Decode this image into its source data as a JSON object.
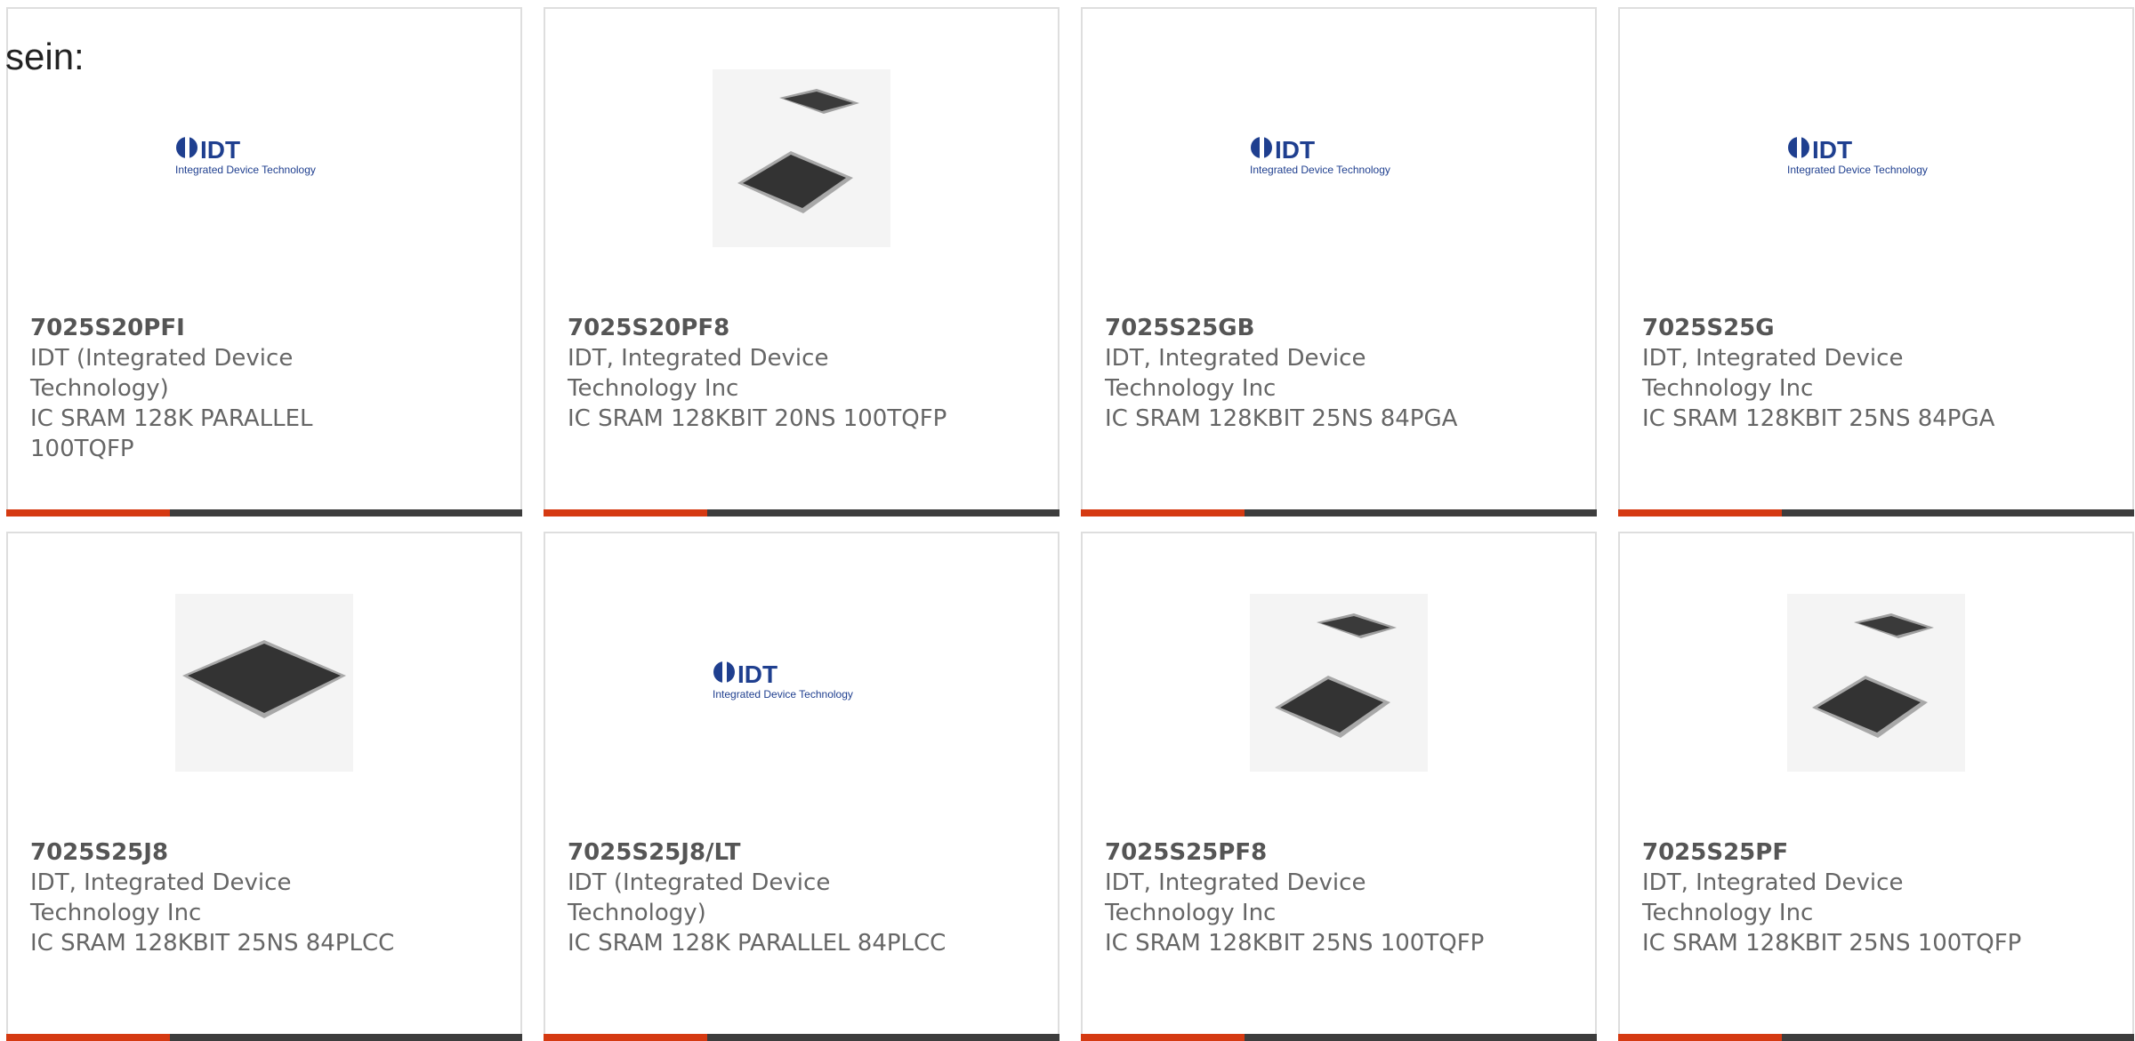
{
  "intro_text": "sein:",
  "colors": {
    "accent_orange": "#d53a12",
    "accent_dark": "#3d3d3d",
    "text": "#555555",
    "idt_blue": "#1f3f8f"
  },
  "logo": {
    "brand": "IDT",
    "tagline": "Integrated Device Technology"
  },
  "products": [
    {
      "part": "7025S20PFI",
      "manufacturer": "IDT (Integrated Device Technology)",
      "description": "IC SRAM 128K PARALLEL 100TQFP",
      "image": "idt-logo"
    },
    {
      "part": "7025S20PF8",
      "manufacturer": "IDT, Integrated Device Technology Inc",
      "description": "IC SRAM 128KBIT 20NS 100TQFP",
      "image": "tqfp-chips-photo"
    },
    {
      "part": "7025S25GB",
      "manufacturer": "IDT, Integrated Device Technology Inc",
      "description": "IC SRAM 128KBIT 25NS 84PGA",
      "image": "idt-logo"
    },
    {
      "part": "7025S25G",
      "manufacturer": "IDT, Integrated Device Technology Inc",
      "description": "IC SRAM 128KBIT 25NS 84PGA",
      "image": "idt-logo"
    },
    {
      "part": "7025S25J8",
      "manufacturer": "IDT, Integrated Device Technology Inc",
      "description": "IC SRAM 128KBIT 25NS 84PLCC",
      "image": "plcc-chip-photo"
    },
    {
      "part": "7025S25J8/LT",
      "manufacturer": "IDT (Integrated Device Technology)",
      "description": "IC SRAM 128K PARALLEL 84PLCC",
      "image": "idt-logo"
    },
    {
      "part": "7025S25PF8",
      "manufacturer": "IDT, Integrated Device Technology Inc",
      "description": "IC SRAM 128KBIT 25NS 100TQFP",
      "image": "tqfp-chips-photo"
    },
    {
      "part": "7025S25PF",
      "manufacturer": "IDT, Integrated Device Technology Inc",
      "description": "IC SRAM 128KBIT 25NS 100TQFP",
      "image": "tqfp-chips-photo"
    }
  ]
}
